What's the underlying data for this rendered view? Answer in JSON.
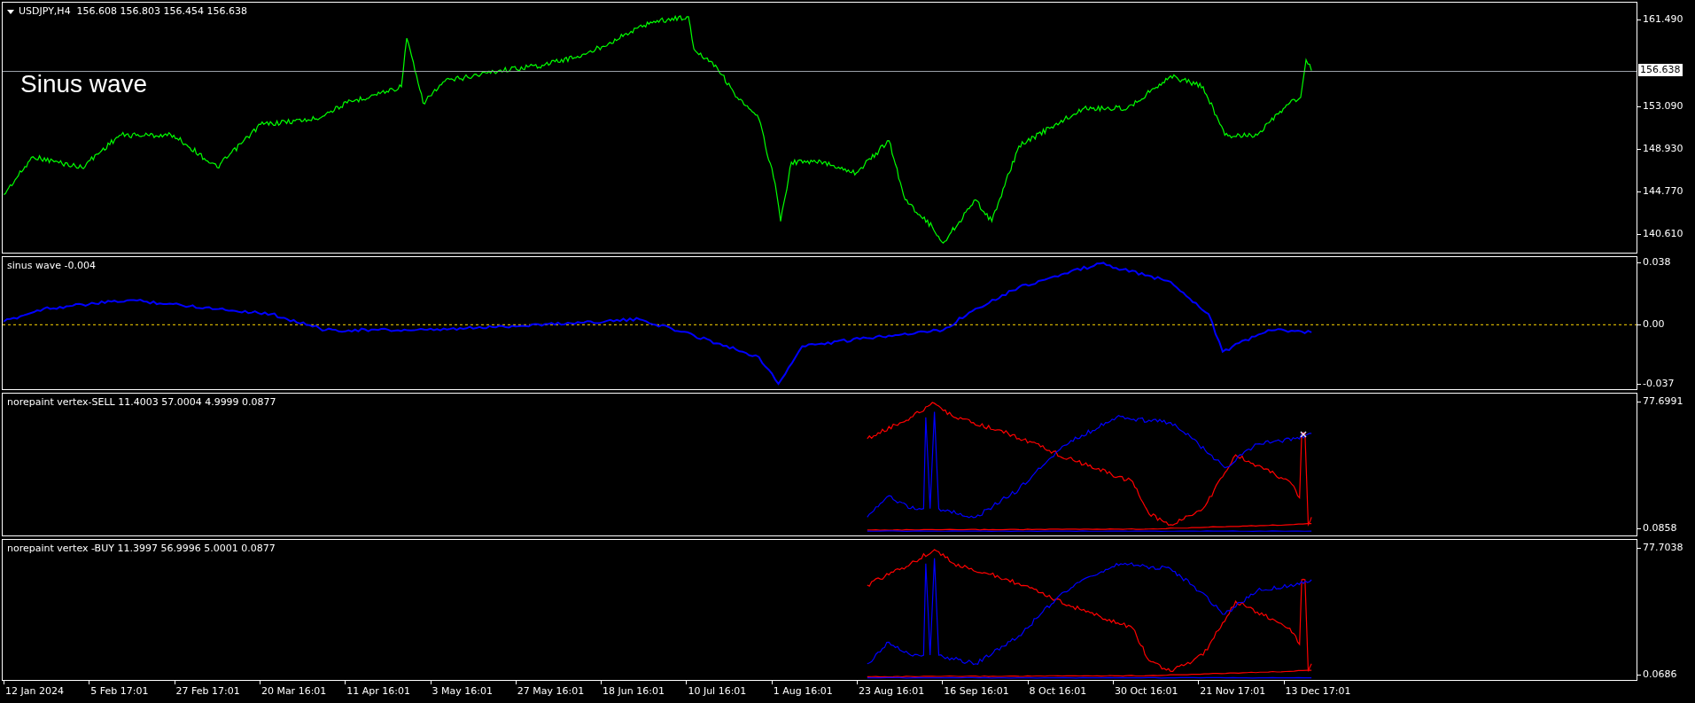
{
  "panels": [
    {
      "kind": "price",
      "header": "USDJPY,H4  156.608 156.803 156.454 156.638",
      "overlay_title": "Sinus wave",
      "current_price": "156.638",
      "axis_labels": [
        "161.490",
        "153.090",
        "148.930",
        "144.770",
        "140.610"
      ]
    },
    {
      "kind": "oscillator",
      "header": "sinus wave -0.004",
      "axis_labels": [
        "0.038",
        "0.00",
        "-0.037"
      ]
    },
    {
      "kind": "vertex_sell",
      "header": "norepaint vertex-SELL 11.4003 57.0004 4.9999 0.0877",
      "axis_labels": [
        "77.6991",
        "0.0858"
      ]
    },
    {
      "kind": "vertex_buy",
      "header": "norepaint vertex -BUY 11.3997 56.9996 5.0001 0.0877",
      "axis_labels": [
        "77.7038",
        "0.0686"
      ]
    }
  ],
  "time_axis": [
    "12 Jan 2024",
    "5 Feb 17:01",
    "27 Feb 17:01",
    "20 Mar 16:01",
    "11 Apr 16:01",
    "3 May 16:01",
    "27 May 16:01",
    "18 Jun 16:01",
    "10 Jul 16:01",
    "1 Aug 16:01",
    "23 Aug 16:01",
    "16 Sep 16:01",
    "8 Oct 16:01",
    "30 Oct 16:01",
    "21 Nov 17:01",
    "13 Dec 17:01"
  ]
}
